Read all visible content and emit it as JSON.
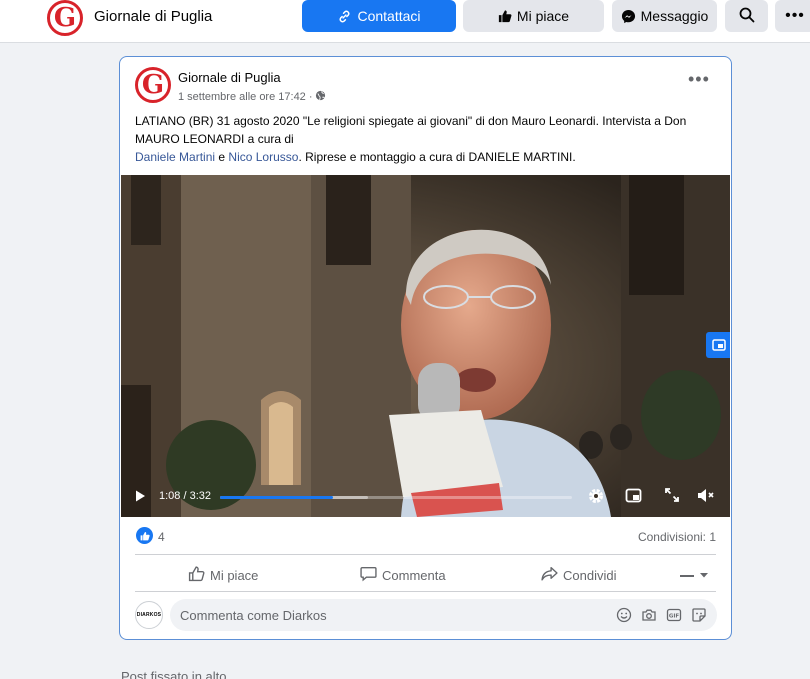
{
  "header": {
    "logo_letter": "G",
    "page_name": "Giornale di Puglia",
    "contact_label": "Contattaci",
    "like_label": "Mi piace",
    "message_label": "Messaggio",
    "search_icon": "search-icon",
    "more_icon": "more-icon"
  },
  "post": {
    "logo_letter": "G",
    "author": "Giornale di Puglia",
    "timestamp": "1 settembre alle ore 17:42",
    "audience_icon": "globe-icon",
    "text_line1": "LATIANO (BR) 31 agosto 2020 \"Le religioni spiegate ai giovani\" di don Mauro Leonardi. Intervista a Don MAURO LEONARDI a cura di",
    "tag1": "Daniele Martini",
    "conj": "e",
    "tag2": "Nico Lorusso",
    "text_line2": ". Riprese e montaggio a cura di DANIELE MARTINI.",
    "video": {
      "current_time": "1:08",
      "separator": "/",
      "duration": "3:32",
      "progress_fraction": 0.32,
      "buffered_fraction": 0.42
    },
    "reactions": {
      "count": "4",
      "shares": "Condivisioni: 1"
    },
    "actions": {
      "like": "Mi piace",
      "comment": "Commenta",
      "share": "Condividi"
    },
    "composer": {
      "avatar_text": "DIARKOS",
      "placeholder": "Commenta come Diarkos"
    }
  },
  "footer": {
    "pinned_label": "Post fissato in alto"
  },
  "colors": {
    "brand_red": "#d8232a",
    "facebook_blue": "#1877f2",
    "link": "#385898"
  }
}
